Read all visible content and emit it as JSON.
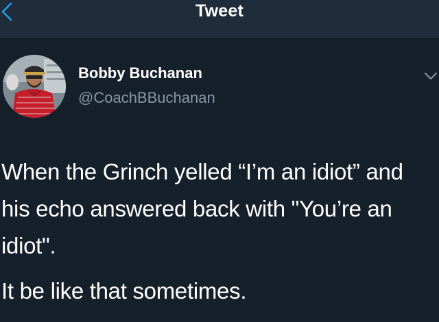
{
  "header": {
    "title": "Tweet",
    "back_icon": "chevron-left-icon",
    "accent_color": "#1da1f2"
  },
  "author": {
    "display_name": "Bobby Buchanan",
    "handle": "@CoachBBuchanan",
    "avatar_icon": "profile-photo"
  },
  "tweet": {
    "paragraphs": [
      "When the Grinch yelled “I’m an idiot” and his echo answered back with \"You’re an idiot\".",
      "It be like that sometimes."
    ],
    "menu_icon": "chevron-down-icon"
  },
  "colors": {
    "background": "#15202b",
    "header_background": "#1f2c3a",
    "secondary_text": "#8899a6"
  }
}
